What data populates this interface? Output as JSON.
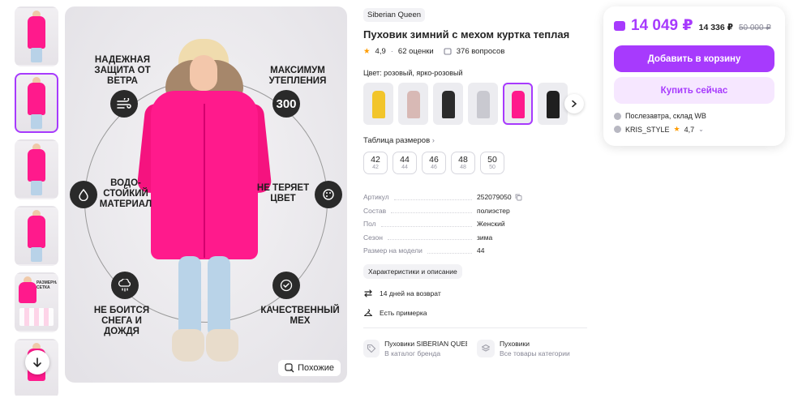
{
  "gallery": {
    "thumbnails": [
      "thumb-1",
      "thumb-2",
      "thumb-3",
      "thumb-4",
      "thumb-5",
      "thumb-6"
    ],
    "size_table_thumb_label": "РАЗМЕРНАЯ СЕТКА",
    "features": [
      {
        "text": "НАДЕЖНАЯ\nЗАЩИТА ОТ\nВЕТРА",
        "icon": "wind-icon"
      },
      {
        "text": "МАКСИМУМ\nУТЕПЛЕНИЯ",
        "icon_text": "300"
      },
      {
        "text": "ВОДО-\nСТОЙКИЙ\nМАТЕРИАЛ",
        "icon": "water-drop-icon"
      },
      {
        "text": "НЕ ТЕРЯЕТ\nЦВЕТ",
        "icon": "palette-icon"
      },
      {
        "text": "НЕ БОИТСЯ\nСНЕГА И\nДОЖДЯ",
        "icon": "snow-cloud-icon"
      },
      {
        "text": "КАЧЕСТВЕННЫЙ\nМЕХ",
        "icon": "badge-check-icon"
      }
    ],
    "similar_label": "Похожие"
  },
  "product": {
    "brand": "Siberian Queen",
    "title": "Пуховик зимний с мехом куртка теплая",
    "rating": "4,9",
    "ratings_count": "62 оценки",
    "questions": "376 вопросов",
    "color_label": "Цвет: розовый, ярко-розовый",
    "color_swatches": [
      "#f2c52b",
      "#d8b9b5",
      "#2b2b2b",
      "#c9c9d0",
      "#ff1a8c",
      "#1f1f1f"
    ],
    "sizes_title": "Таблица размеров",
    "sizes": [
      {
        "ru": "42",
        "sub": "42"
      },
      {
        "ru": "44",
        "sub": "44"
      },
      {
        "ru": "46",
        "sub": "46"
      },
      {
        "ru": "48",
        "sub": "48"
      },
      {
        "ru": "50",
        "sub": "50"
      }
    ],
    "specs": [
      {
        "k": "Артикул",
        "v": "252079050"
      },
      {
        "k": "Состав",
        "v": "полиэстер"
      },
      {
        "k": "Пол",
        "v": "Женский"
      },
      {
        "k": "Сезон",
        "v": "зима"
      },
      {
        "k": "Размер на модели",
        "v": "44"
      }
    ],
    "characteristics_btn": "Характеристики и описание",
    "return_text": "14 дней на возврат",
    "fitting_text": "Есть примерка",
    "categories": [
      {
        "title": "Пуховики SIBERIAN QUEEN",
        "sub": "В каталог бренда"
      },
      {
        "title": "Пуховики",
        "sub": "Все товары категории"
      }
    ]
  },
  "buy": {
    "price": "14 049 ₽",
    "price_mid": "14 336 ₽",
    "price_old": "50 000 ₽",
    "add_to_cart": "Добавить в корзину",
    "buy_now": "Купить сейчас",
    "delivery": "Послезавтра, склад WB",
    "seller": "KRIS_STYLE",
    "seller_rating": "4,7",
    "accent": "#a73afd"
  }
}
